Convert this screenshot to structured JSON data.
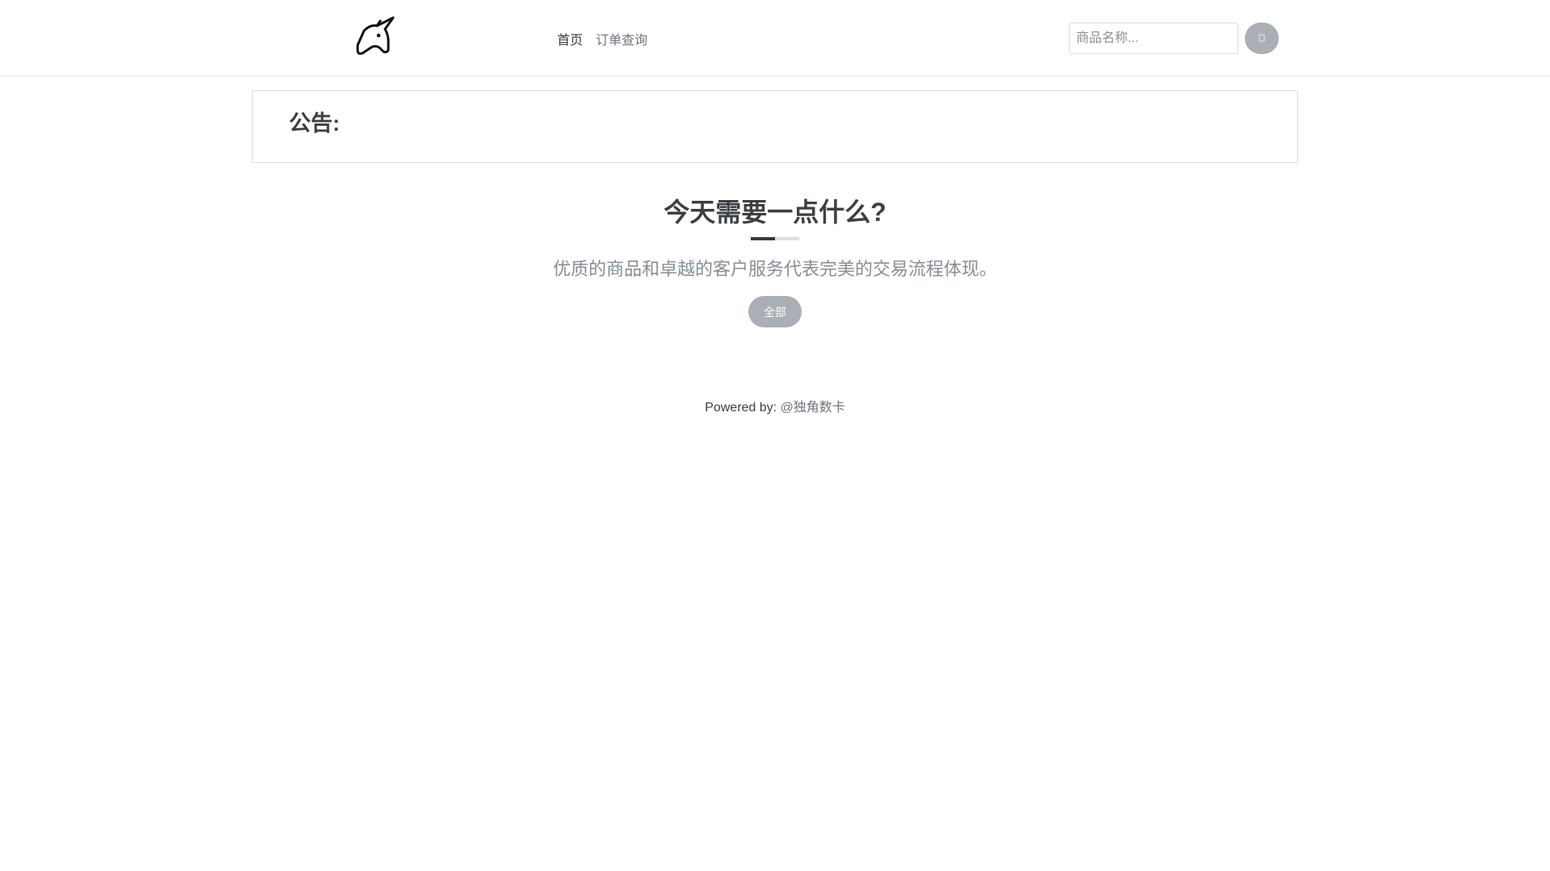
{
  "header": {
    "logo_icon": "unicorn-logo-icon",
    "nav": [
      {
        "label": "首页",
        "active": true
      },
      {
        "label": "订单查询",
        "active": false
      }
    ],
    "search": {
      "placeholder": "商品名称...",
      "value": "",
      "button_icon": "search-icon"
    }
  },
  "notice": {
    "title": "公告:"
  },
  "hero": {
    "title": "今天需要一点什么?",
    "subtitle": "优质的商品和卓越的客户服务代表完美的交易流程体现。"
  },
  "categories": [
    {
      "label": "全部"
    }
  ],
  "footer": {
    "prefix": "Powered by:",
    "link_text": "@独角数卡"
  },
  "colors": {
    "button_gray": "#a9afb5",
    "text_dark": "#3c4043",
    "text_muted": "#868e96",
    "border": "#dcdcdc"
  }
}
